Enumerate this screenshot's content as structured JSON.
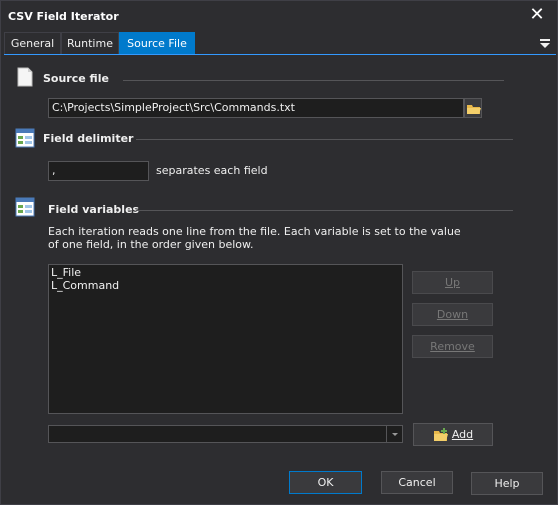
{
  "window": {
    "title": "CSV Field Iterator",
    "close_glyph": "✕"
  },
  "tabs": [
    {
      "label": "General",
      "active": false
    },
    {
      "label": "Runtime",
      "active": false
    },
    {
      "label": "Source File",
      "active": true
    }
  ],
  "source_file": {
    "title": "Source file",
    "path": "C:\\Projects\\SimpleProject\\Src\\Commands.txt",
    "icon": "document-icon",
    "browse_icon": "folder-icon"
  },
  "field_delimiter": {
    "title": "Field delimiter",
    "value": ",",
    "suffix": "separates each field",
    "icon": "form-icon"
  },
  "field_variables": {
    "title": "Field variables",
    "description_line1": "Each iteration reads one line from the file. Each variable is set to the value",
    "description_line2": "of one field, in the order given below.",
    "icon": "form-icon",
    "items": [
      "L_File",
      "L_Command"
    ],
    "up_label": "Up",
    "down_label": "Down",
    "remove_label": "Remove",
    "combo_value": "",
    "add_label": "Add",
    "add_icon": "folder-add-icon"
  },
  "footer": {
    "ok_label": "OK",
    "cancel_label": "Cancel",
    "help_label": "Help"
  },
  "colors": {
    "accent": "#007acc",
    "background": "#2d2d30",
    "field": "#1e1e1e"
  }
}
